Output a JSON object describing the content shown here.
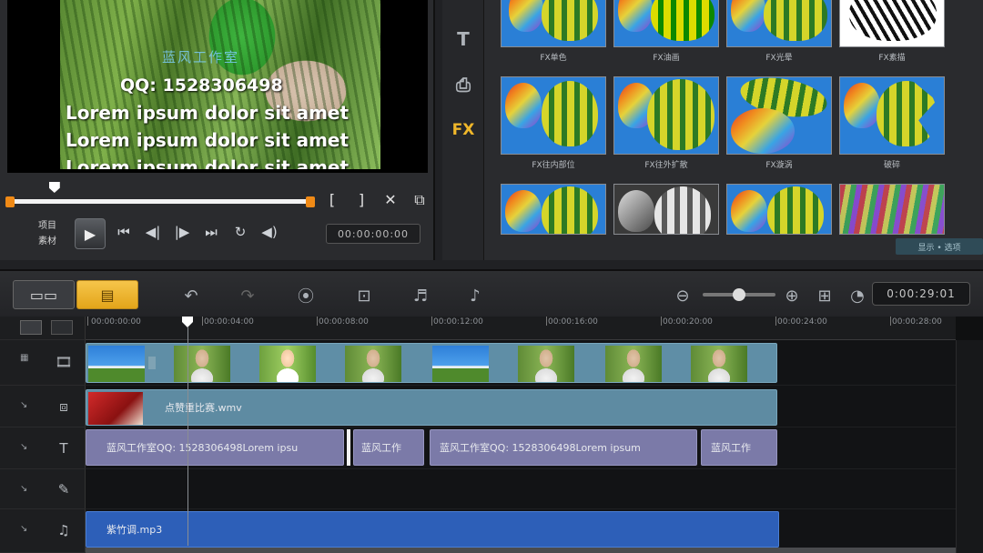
{
  "preview": {
    "overlay_studio": "蓝风工作室",
    "overlay_qq": "QQ: 1528306498",
    "overlay_lorem": [
      "Lorem ipsum dolor sit amet",
      "Lorem ipsum dolor sit amet",
      "Lorem ipsum dolor sit amet"
    ],
    "mode_labels": [
      "项目",
      "素材"
    ],
    "play_icon": "▶",
    "transport_icons": [
      "⏮",
      "◀|",
      "|▶",
      "⏭",
      "↻",
      "◀)"
    ],
    "trim_icons": [
      "[",
      "]",
      "✕",
      "⧉"
    ],
    "timecode": "00:00:00:00",
    "progress_fraction": 0.15
  },
  "library": {
    "side_icons": [
      "T",
      "⎙",
      "FX"
    ],
    "thumb_labels": [
      [
        "FX单色",
        "FX油画",
        "FX光晕",
        "FX素描"
      ],
      [
        "FX往内部位",
        "FX往外扩散",
        "FX漩涡",
        "破碎"
      ],
      [
        "",
        "",
        "",
        ""
      ]
    ],
    "status_text": "显示 • 选项"
  },
  "toolbar": {
    "storyboard_icon": "▭▭",
    "timeline_icon": "▤",
    "undo_icon": "↶",
    "redo_icon": "↷",
    "record_icon": "⦿",
    "capture_icon": "⊡",
    "audio_mix_icon": "♬",
    "auto_music_icon": "♪",
    "zoom_out_icon": "⊖",
    "zoom_in_icon": "⊕",
    "fit_icon": "⊞",
    "clock_icon": "◔",
    "timecode": "0:00:29:01",
    "zoom_fraction": 0.5
  },
  "timeline": {
    "ruler_labels": [
      "00:00:00:00",
      "00:00:04:00",
      "00:00:08:00",
      "00:00:12:00",
      "00:00:16:00",
      "00:00:20:00",
      "00:00:24:00",
      "00:00:28:00"
    ],
    "overlay_clip_label": "点赞重比赛.wmv",
    "title_clips": [
      "蓝风工作室QQ: 1528306498Lorem ipsu",
      "蓝风工作",
      "蓝风工作室QQ: 1528306498Lorem ipsum",
      "蓝风工作"
    ],
    "audio_clip_label": "紫竹调.mp3",
    "track_icons": [
      "🎞",
      "⧈",
      "T",
      "✎",
      "♫"
    ]
  }
}
